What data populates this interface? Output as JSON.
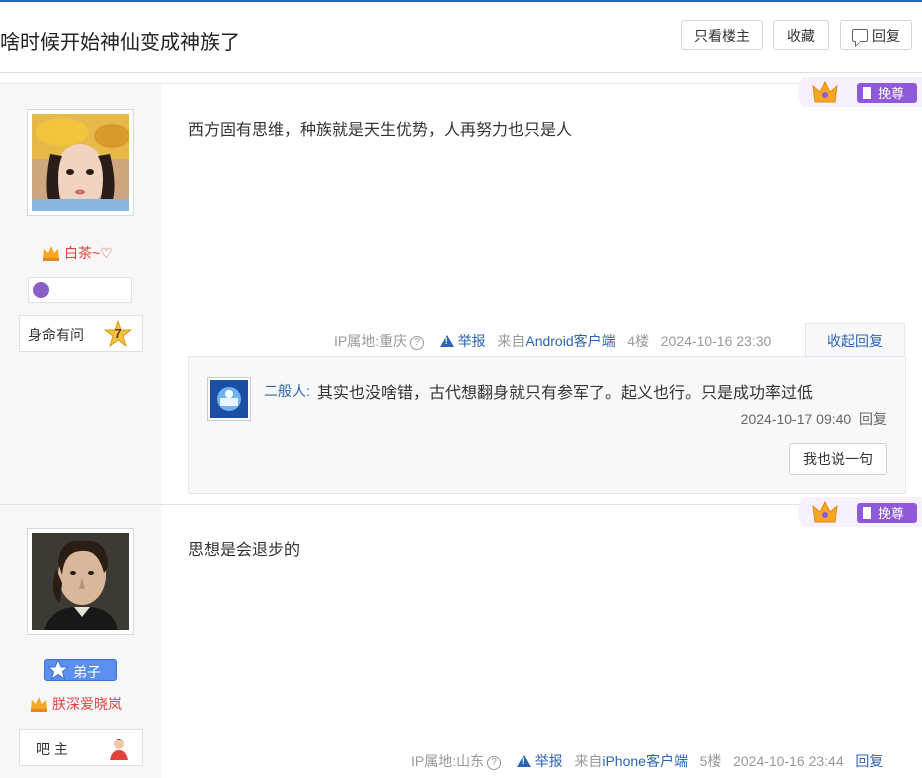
{
  "header": {
    "title": "啥时候开始神仙变成神族了",
    "btn_only_op": "只看楼主",
    "btn_favorite": "收藏",
    "btn_reply": "回复"
  },
  "tag_label": "挽尊",
  "posts": [
    {
      "username": "白茶~♡",
      "level_name": "身命有问",
      "level_num": "7",
      "content": "西方固有思维，种族就是天生优势，人再努力也只是人",
      "ip": "IP属地:重庆",
      "report": "举报",
      "source_prefix": "来自",
      "source": "Android客户端",
      "floor": "4楼",
      "time": "2024-10-16 23:30",
      "collapse": "收起回复",
      "replies": [
        {
          "user": "二般人:",
          "text": "其实也没啥错，古代想翻身就只有参军了。起义也行。只是成功率过低",
          "time": "2024-10-17 09:40",
          "reply_label": "回复"
        }
      ],
      "say_button": "我也说一句"
    },
    {
      "username": "朕深爱晓岚",
      "rank_badge": "弟子",
      "level_name": "吧 主",
      "content": "思想是会退步的",
      "ip": "IP属地:山东",
      "report": "举报",
      "source_prefix": "来自",
      "source": "iPhone客户端",
      "floor": "5楼",
      "time": "2024-10-16 23:44",
      "reply_label": "回复"
    }
  ]
}
